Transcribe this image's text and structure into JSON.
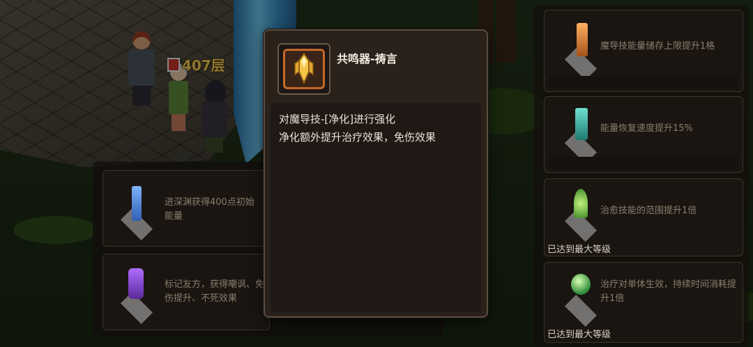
{
  "hud": {
    "floor_label": "407层"
  },
  "tooltip": {
    "title": "共鸣器-祷言",
    "icon": "resonator-crystal-icon",
    "desc_lines": [
      "对魔导技-[净化]进行强化",
      "净化额外提升治疗效果，免伤效果"
    ]
  },
  "left_items": [
    {
      "icon": "blue-crystal-icon",
      "text": "进深渊获得400点初始能量"
    },
    {
      "icon": "purple-crystal-icon",
      "text": "标记友方，获得嘲讽、免伤提升、不死效果"
    }
  ],
  "right_items": [
    {
      "icon": "orange-crystal-icon",
      "text": "魔导技能量储存上限提升1格",
      "status": ""
    },
    {
      "icon": "teal-crystal-icon",
      "text": "能量恢复速度提升15%",
      "status": ""
    },
    {
      "icon": "green-sprout-icon",
      "text": "治愈技能的范围提升1倍",
      "status": "已达到最大等级"
    },
    {
      "icon": "green-orb-icon",
      "text": "治疗对单体生效，持续时间消耗提升1倍",
      "status": "已达到最大等级"
    }
  ],
  "colors": {
    "accent": "#c46a28",
    "text_bright": "#eae3d6",
    "text_dim": "#8b7d6c"
  }
}
